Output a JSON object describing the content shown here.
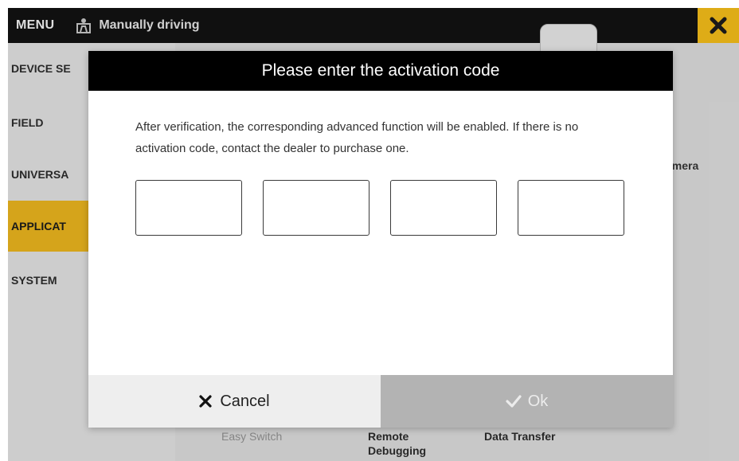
{
  "topbar": {
    "menu_label": "MENU",
    "mode_label": "Manually driving",
    "mode_icon": "person-in-cab-icon",
    "close_icon": "close-icon",
    "accent_color": "#e6b218"
  },
  "sidebar": {
    "items": [
      {
        "label": "DEVICE SE",
        "active": false
      },
      {
        "label": "FIELD",
        "active": false
      },
      {
        "label": "UNIVERSA",
        "active": false
      },
      {
        "label": "APPLICAT",
        "active": true
      },
      {
        "label": "SYSTEM",
        "active": false
      }
    ],
    "active_color": "#dcaa1c"
  },
  "content": {
    "camera_label": "amera",
    "bottom_items": [
      "Easy Switch",
      "Remote\nDebugging",
      "Data Transfer"
    ]
  },
  "dialog": {
    "title": "Please enter the activation code",
    "message": "After verification, the corresponding advanced function will be enabled. If there is no activation code, contact the dealer to purchase one.",
    "code_fields": [
      "",
      "",
      "",
      ""
    ],
    "cancel_label": "Cancel",
    "ok_label": "Ok",
    "cancel_icon": "close-icon",
    "ok_icon": "checkmark-icon"
  }
}
